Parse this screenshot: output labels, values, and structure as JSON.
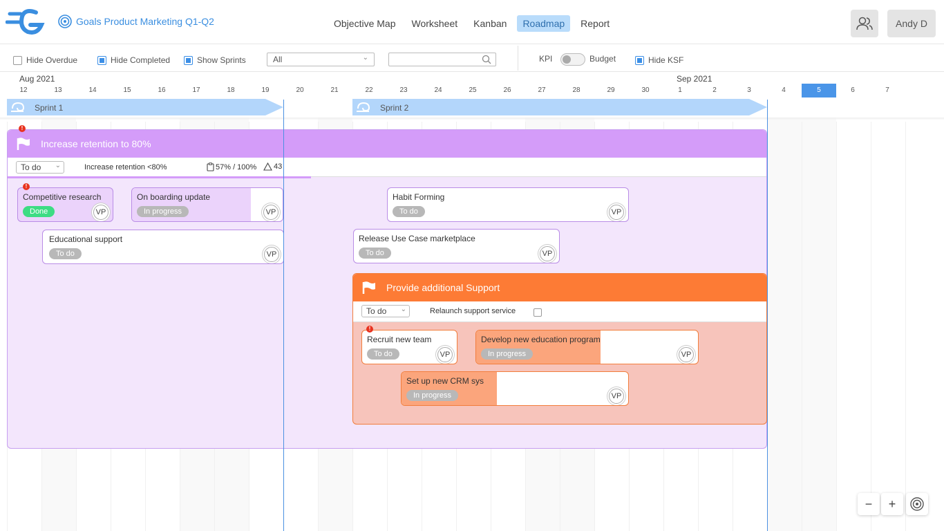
{
  "header": {
    "project_title": "Goals Product Marketing Q1-Q2",
    "nav": [
      "Objective Map",
      "Worksheet",
      "Kanban",
      "Roadmap",
      "Report"
    ],
    "active_nav": "Roadmap",
    "user": "Andy D"
  },
  "toolbar": {
    "hide_overdue": "Hide Overdue",
    "hide_completed": "Hide Completed",
    "show_sprints": "Show Sprints",
    "filter_value": "All",
    "search_placeholder": "",
    "kpi": "KPI",
    "budget": "Budget",
    "hide_ksf": "Hide KSF",
    "checks": {
      "hide_overdue": false,
      "hide_completed": true,
      "show_sprints": true,
      "hide_ksf": true
    }
  },
  "timeline": {
    "months": [
      "Aug 2021",
      "Sep 2021"
    ],
    "days": [
      "12",
      "13",
      "14",
      "15",
      "16",
      "17",
      "18",
      "19",
      "20",
      "21",
      "22",
      "23",
      "24",
      "25",
      "26",
      "27",
      "28",
      "29",
      "30",
      "1",
      "2",
      "3",
      "4",
      "5",
      "6",
      "7"
    ],
    "today": "5",
    "sprints": [
      "Sprint 1",
      "Sprint 2"
    ]
  },
  "goal1": {
    "title": "Increase retention to 80%",
    "status": "To do",
    "kr": "Increase retention <80%",
    "progress": "57% / 100%",
    "count": "43",
    "progress_value": 0.4
  },
  "cards": [
    {
      "name": "Competitive research",
      "status": "Done",
      "avatar": "VP"
    },
    {
      "name": "On boarding update",
      "status": "In progress",
      "avatar": "VP"
    },
    {
      "name": "Educational support",
      "status": "To do",
      "avatar": "VP"
    },
    {
      "name": "Habit Forming",
      "status": "To do",
      "avatar": "VP"
    },
    {
      "name": "Release Use Case marketplace",
      "status": "To do",
      "avatar": "VP"
    }
  ],
  "goal2": {
    "title": "Provide additional Support",
    "status": "To do",
    "kr": "Relaunch support service"
  },
  "cards2": [
    {
      "name": "Recruit new team",
      "status": "To do",
      "avatar": "VP"
    },
    {
      "name": "Develop new education program",
      "status": "In progress",
      "avatar": "VP"
    },
    {
      "name": "Set up new CRM sys",
      "status": "In progress",
      "avatar": "VP"
    }
  ],
  "zoom": {
    "minus": "−",
    "plus": "+"
  },
  "colors": {
    "purple_head": "#d49cf9",
    "orange_head": "#fd7b35",
    "accent": "#4a95e8"
  },
  "icons": [
    "logo-icon",
    "target-icon",
    "users-icon",
    "search-icon",
    "flag-icon",
    "sprint-icon",
    "clipboard-icon",
    "triangle-icon",
    "alert-icon",
    "focus-icon"
  ]
}
